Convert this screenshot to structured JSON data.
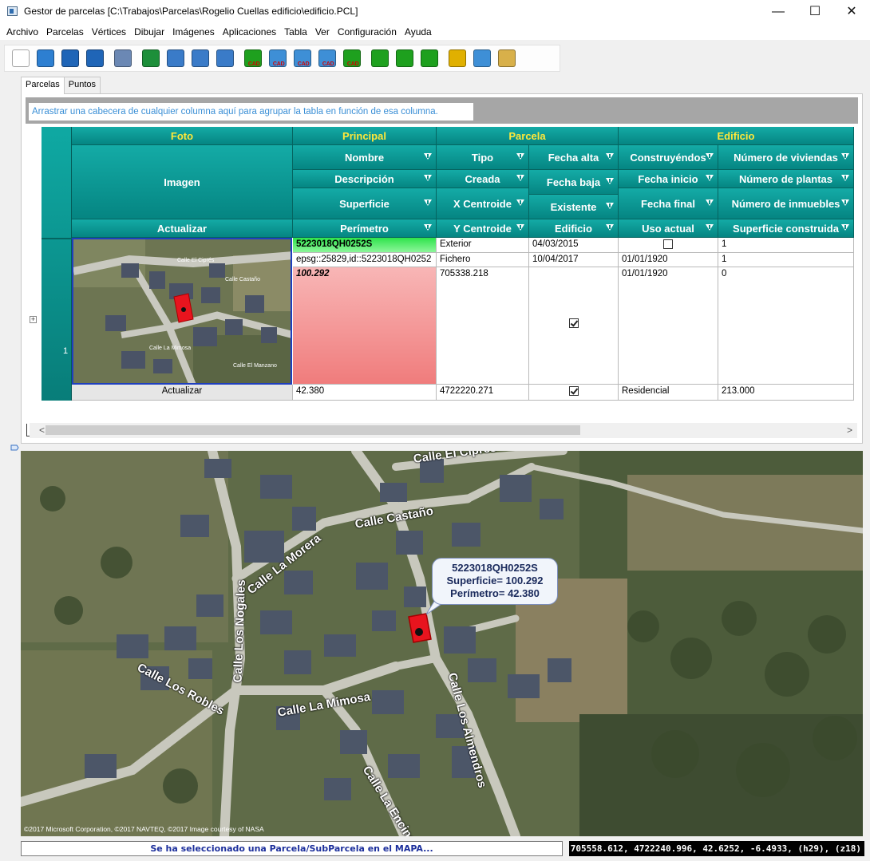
{
  "window": {
    "title": "Gestor de parcelas [C:\\Trabajos\\Parcelas\\Rogelio Cuellas edificio\\edificio.PCL]",
    "controls": {
      "minimize": "—",
      "maximize": "☐",
      "close": "✕"
    }
  },
  "menu": [
    "Archivo",
    "Parcelas",
    "Vértices",
    "Dibujar",
    "Imágenes",
    "Aplicaciones",
    "Tabla",
    "Ver",
    "Configuración",
    "Ayuda"
  ],
  "toolbar": {
    "buttons": [
      {
        "icon": "new-document-icon",
        "color": "#ffffff",
        "cad": ""
      },
      {
        "icon": "open-folder-icon",
        "color": "#2d7fd1",
        "cad": ""
      },
      {
        "icon": "save-icon",
        "color": "#1f65b7",
        "cad": ""
      },
      {
        "icon": "save-as-icon",
        "color": "#1f65b7",
        "cad": ""
      },
      {
        "icon": "print-icon",
        "color": "#6b88b4",
        "cad": ""
      },
      {
        "icon": "excel-icon",
        "color": "#1d8f3a",
        "cad": ""
      },
      {
        "icon": "gml-table-icon",
        "color": "#3a7bc8",
        "cad": ""
      },
      {
        "icon": "gml-table-2-icon",
        "color": "#3a7bc8",
        "cad": ""
      },
      {
        "icon": "shp-table-icon",
        "color": "#3a7bc8",
        "cad": ""
      },
      {
        "icon": "export-cad-icon",
        "color": "#1ea01e",
        "cad": "CAD"
      },
      {
        "icon": "add-cad-icon",
        "color": "#3e8fd6",
        "cad": "CAD"
      },
      {
        "icon": "image-cad-icon",
        "color": "#3e8fd6",
        "cad": "CAD"
      },
      {
        "icon": "points-cad-icon",
        "color": "#3e8fd6",
        "cad": "CAD"
      },
      {
        "icon": "search-cad-icon",
        "color": "#1ea01e",
        "cad": "CAD"
      },
      {
        "icon": "measure-icon",
        "color": "#1ea01e",
        "cad": ""
      },
      {
        "icon": "parcel-shape-icon",
        "color": "#1ea01e",
        "cad": ""
      },
      {
        "icon": "area-m2-icon",
        "color": "#1ea01e",
        "cad": ""
      },
      {
        "icon": "transfer-icon",
        "color": "#e0b000",
        "cad": ""
      },
      {
        "icon": "layers-icon",
        "color": "#3e8fd6",
        "cad": ""
      },
      {
        "icon": "zoom-tools-icon",
        "color": "#d8b04a",
        "cad": ""
      }
    ]
  },
  "tabs": [
    {
      "label": "Parcelas",
      "active": true
    },
    {
      "label": "Puntos",
      "active": false
    }
  ],
  "grid": {
    "group_hint": "Arrastrar una cabecera de cualquier columna aquí para agrupar la tabla en función de esa columna.",
    "bands": [
      "Foto",
      "Principal",
      "Parcela",
      "Edificio"
    ],
    "headers": {
      "imagen": "Imagen",
      "actualizar": "Actualizar",
      "nombre": "Nombre",
      "descripcion": "Descripción",
      "superficie": "Superficie",
      "perimetro": "Perímetro",
      "tipo": "Tipo",
      "creada": "Creada",
      "x_centroide": "X Centroide",
      "y_centroide": "Y Centroide",
      "fecha_alta": "Fecha alta",
      "fecha_baja": "Fecha baja",
      "existente": "Existente",
      "edificio": "Edificio",
      "construyendos": "Construyéndos",
      "fecha_inicio": "Fecha inicio",
      "fecha_final": "Fecha final",
      "uso_actual": "Uso actual",
      "num_viviendas": "Número de viviendas",
      "num_plantas": "Número de plantas",
      "num_inmuebles": "Número de inmuebles",
      "superficie_construida": "Superficie construida"
    },
    "row": {
      "number": "1",
      "expander": "+",
      "actualizar": "Actualizar",
      "nombre": "5223018QH0252S",
      "descripcion": "epsg::25829,id::5223018QH0252",
      "superficie": "100.292",
      "perimetro": "42.380",
      "tipo": "Exterior",
      "creada": "Fichero",
      "x_centroide": "705338.218",
      "y_centroide": "4722220.271",
      "fecha_alta": "04/03/2015",
      "fecha_baja": "10/04/2017",
      "existente": true,
      "edificio": true,
      "construyendos": false,
      "fecha_inicio": "01/01/1920",
      "fecha_final": "01/01/1920",
      "uso_actual": "Residencial",
      "num_viviendas": "1",
      "num_plantas": "1",
      "num_inmuebles": "0",
      "superficie_construida": "213.000"
    },
    "thumbnail_labels": [
      "Calle El Ciprés",
      "Calle Castaño",
      "Calle La Mimosa",
      "Calle El Manzano"
    ],
    "scroll": {
      "left": "<",
      "right": ">"
    }
  },
  "map": {
    "callout": {
      "name": "5223018QH0252S",
      "superficie": "Superficie= 100.292",
      "perimetro": "Perímetro= 42.380"
    },
    "streets": [
      "Calle El Ciprés",
      "Calle Castaño",
      "Calle La Morera",
      "Calle Los Nogales",
      "Calle Los Robles",
      "Calle La Mimosa",
      "Calle Los Almendros",
      "Calle La Encina"
    ],
    "copyright": "©2017 Microsoft Corporation, ©2017 NAVTEQ, ©2017 Image courtesy of NASA",
    "parcel_color": "#e8141e"
  },
  "status": {
    "message": "Se ha seleccionado una Parcela/SubParcela en el MAPA...",
    "coords": "705558.612, 4722240.996, 42.6252, -6.4933, (h29), (z18)"
  }
}
